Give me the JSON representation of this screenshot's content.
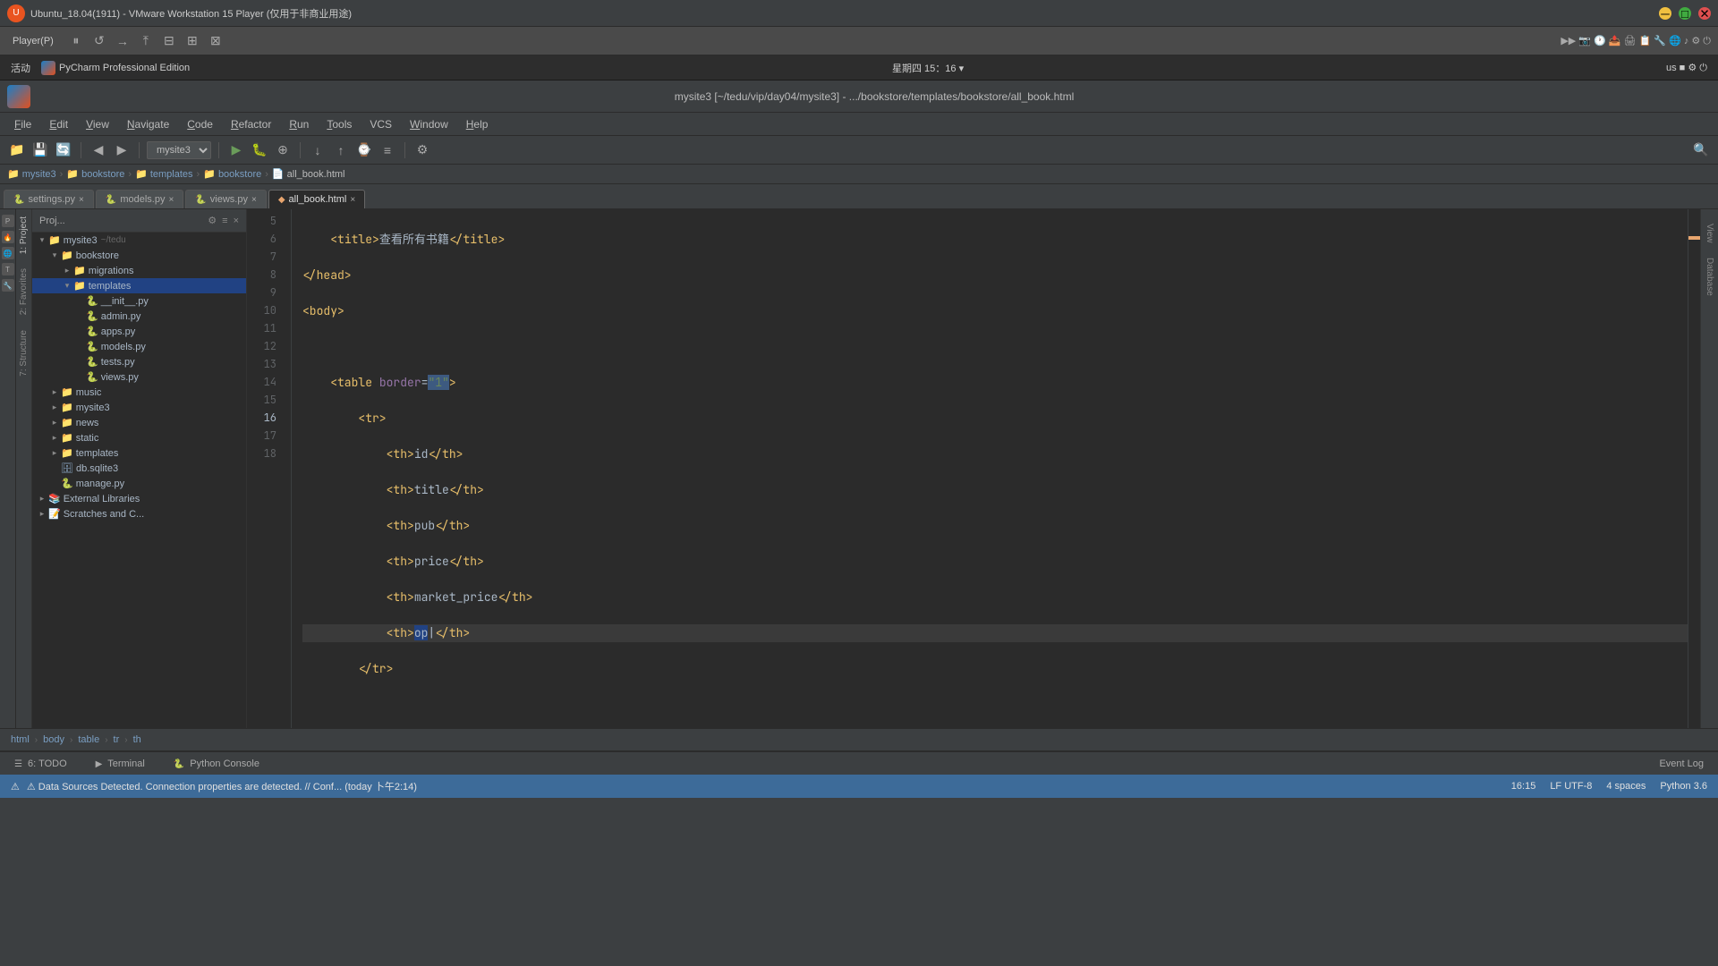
{
  "window": {
    "title": "Ubuntu_18.04(1911) - VMware Workstation 15 Player (仅用于非商业用途)",
    "titlebar_text": "Ubuntu_18.04(1911) - VMware Workstation 15 Player (仅用于非商业用途)"
  },
  "vmware": {
    "player_menu": "Player(P)",
    "controls": [
      "⏸",
      "↩",
      "→",
      "⤒",
      "⊟",
      "⊞",
      "⊠"
    ]
  },
  "ubuntu": {
    "activities": "活动",
    "appname": "PyCharm Professional Edition",
    "datetime": "星期四 15：16 ▾",
    "right_icons": "us ■ ⚙ ⏻"
  },
  "pycharm": {
    "title": "mysite3 [~/tedu/vip/day04/mysite3] - .../bookstore/templates/bookstore/all_book.html"
  },
  "menu": {
    "items": [
      "File",
      "Edit",
      "View",
      "Navigate",
      "Code",
      "Refactor",
      "Run",
      "Tools",
      "VCS",
      "Window",
      "Help"
    ]
  },
  "toolbar": {
    "project_name": "mysite3"
  },
  "breadcrumb": {
    "items": [
      "mysite3",
      "bookstore",
      "templates",
      "bookstore",
      "all_book.html"
    ]
  },
  "tabs": [
    {
      "name": "settings.py",
      "modified": false,
      "active": false
    },
    {
      "name": "models.py",
      "modified": false,
      "active": false
    },
    {
      "name": "views.py",
      "modified": false,
      "active": false
    },
    {
      "name": "all_book.html",
      "modified": false,
      "active": true
    }
  ],
  "sidebar": {
    "header": "Proj...",
    "root": "mysite3",
    "root_path": "~/tedu",
    "tree": [
      {
        "label": "mysite3",
        "type": "root",
        "level": 0,
        "expanded": true
      },
      {
        "label": "bookstore",
        "type": "folder",
        "level": 1,
        "expanded": true
      },
      {
        "label": "migrations",
        "type": "folder",
        "level": 2,
        "expanded": false
      },
      {
        "label": "templates",
        "type": "folder",
        "level": 2,
        "expanded": true
      },
      {
        "label": "__init__.py",
        "type": "py",
        "level": 2
      },
      {
        "label": "admin.py",
        "type": "py",
        "level": 2
      },
      {
        "label": "apps.py",
        "type": "py",
        "level": 2
      },
      {
        "label": "models.py",
        "type": "py",
        "level": 2
      },
      {
        "label": "tests.py",
        "type": "py",
        "level": 2
      },
      {
        "label": "views.py",
        "type": "py",
        "level": 2
      },
      {
        "label": "music",
        "type": "folder",
        "level": 1,
        "expanded": false
      },
      {
        "label": "mysite3",
        "type": "folder",
        "level": 1,
        "expanded": false
      },
      {
        "label": "news",
        "type": "folder",
        "level": 1,
        "expanded": false
      },
      {
        "label": "static",
        "type": "folder",
        "level": 1,
        "expanded": false
      },
      {
        "label": "templates",
        "type": "folder",
        "level": 1,
        "expanded": false
      },
      {
        "label": "db.sqlite3",
        "type": "sqlite",
        "level": 1
      },
      {
        "label": "manage.py",
        "type": "py",
        "level": 1
      },
      {
        "label": "External Libraries",
        "type": "folder",
        "level": 0,
        "expanded": false
      },
      {
        "label": "Scratches and C...",
        "type": "folder",
        "level": 0,
        "expanded": false
      }
    ]
  },
  "code": {
    "lines": [
      {
        "num": 5,
        "content": "    <title>查看所有书籍</title>",
        "type": "html"
      },
      {
        "num": 6,
        "content": "</head>",
        "type": "html"
      },
      {
        "num": 7,
        "content": "<body>",
        "type": "html"
      },
      {
        "num": 8,
        "content": "",
        "type": "blank"
      },
      {
        "num": 9,
        "content": "    <table border=\"1\">",
        "type": "html"
      },
      {
        "num": 10,
        "content": "        <tr>",
        "type": "html"
      },
      {
        "num": 11,
        "content": "            <th>id</th>",
        "type": "html"
      },
      {
        "num": 12,
        "content": "            <th>title</th>",
        "type": "html"
      },
      {
        "num": 13,
        "content": "            <th>pub</th>",
        "type": "html"
      },
      {
        "num": 14,
        "content": "            <th>price</th>",
        "type": "html"
      },
      {
        "num": 15,
        "content": "            <th>market_price</th>",
        "type": "html"
      },
      {
        "num": 16,
        "content": "            <th>op</th>",
        "type": "html",
        "current": true
      },
      {
        "num": 17,
        "content": "        </tr>",
        "type": "html"
      },
      {
        "num": 18,
        "content": "",
        "type": "blank"
      }
    ]
  },
  "path_breadcrumb": {
    "items": [
      "html",
      "body",
      "table",
      "tr",
      "th"
    ]
  },
  "bottom_tabs": [
    {
      "label": "6: TODO",
      "icon": "☰"
    },
    {
      "label": "Terminal",
      "icon": "▶"
    },
    {
      "label": "Python Console",
      "icon": "🐍"
    }
  ],
  "status_bar": {
    "left": "⚠ Data Sources Detected. Connection properties are detected. // Conf... (today 卜午2:14)",
    "position": "16:15",
    "encoding": "LF  UTF-8",
    "indent": "4 spaces",
    "language": "Python 3.6",
    "event_log": "Event Log"
  },
  "right_panel_labels": [
    "View",
    "Database"
  ],
  "left_panel_numbers": [
    "1: Project",
    "2: Favorites",
    "7: Structure"
  ]
}
